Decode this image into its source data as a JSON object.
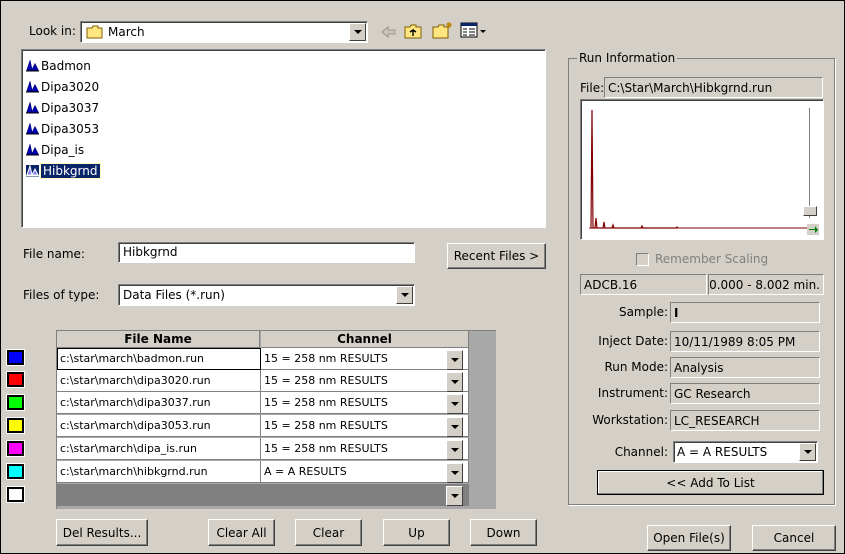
{
  "toolbar": {
    "look_in_label": "Look in:",
    "folder_name": "March"
  },
  "file_list": [
    {
      "name": "Badmon"
    },
    {
      "name": "Dipa3020"
    },
    {
      "name": "Dipa3037"
    },
    {
      "name": "Dipa3053"
    },
    {
      "name": "Dipa_is"
    },
    {
      "name": "Hibkgrnd",
      "selected": true
    }
  ],
  "file_name": {
    "label": "File name:",
    "value": "Hibkgrnd",
    "recent_files_button": "Recent Files >"
  },
  "file_type": {
    "label": "Files of type:",
    "value": "Data Files (*.run)"
  },
  "results_table": {
    "headers": [
      "File Name",
      "Channel"
    ],
    "rows": [
      {
        "color": "#0000ff",
        "file": "c:\\star\\march\\badmon.run",
        "channel": "15 = 258 nm RESULTS"
      },
      {
        "color": "#ff0000",
        "file": "c:\\star\\march\\dipa3020.run",
        "channel": "15 = 258 nm RESULTS"
      },
      {
        "color": "#00ff00",
        "file": "c:\\star\\march\\dipa3037.run",
        "channel": "15 = 258 nm RESULTS"
      },
      {
        "color": "#ffff00",
        "file": "c:\\star\\march\\dipa3053.run",
        "channel": "15 = 258 nm RESULTS"
      },
      {
        "color": "#ff00ff",
        "file": "c:\\star\\march\\dipa_is.run",
        "channel": "15 = 258 nm RESULTS"
      },
      {
        "color": "#00ffff",
        "file": "c:\\star\\march\\hibkgrnd.run",
        "channel": "A = A  RESULTS"
      },
      {
        "color": "#ffffff",
        "file": "",
        "channel": ""
      }
    ]
  },
  "bottom_buttons": {
    "del_results": "Del Results...",
    "clear_all": "Clear All",
    "clear": "Clear",
    "up": "Up",
    "down": "Down",
    "open_files": "Open File(s)",
    "cancel": "Cancel"
  },
  "run_info": {
    "group_title": "Run Information",
    "file_label": "File:",
    "file_path": "C:\\Star\\March\\Hibkgrnd.run",
    "remember_scaling": "Remember Scaling",
    "method": "ADCB.16",
    "time_range": "0.000 - 8.002 min.",
    "sample_label": "Sample:",
    "sample_value": "I",
    "inject_date_label": "Inject Date:",
    "inject_date_value": "10/11/1989 8:05 PM",
    "run_mode_label": "Run Mode:",
    "run_mode_value": "Analysis",
    "instrument_label": "Instrument:",
    "instrument_value": "GC Research",
    "workstation_label": "Workstation:",
    "workstation_value": "LC_RESEARCH",
    "channel_label": "Channel:",
    "channel_value": "A = A  RESULTS",
    "add_to_list": "<< Add To List"
  },
  "colors": {
    "trace": "#800000",
    "selection": "#0a246a"
  }
}
